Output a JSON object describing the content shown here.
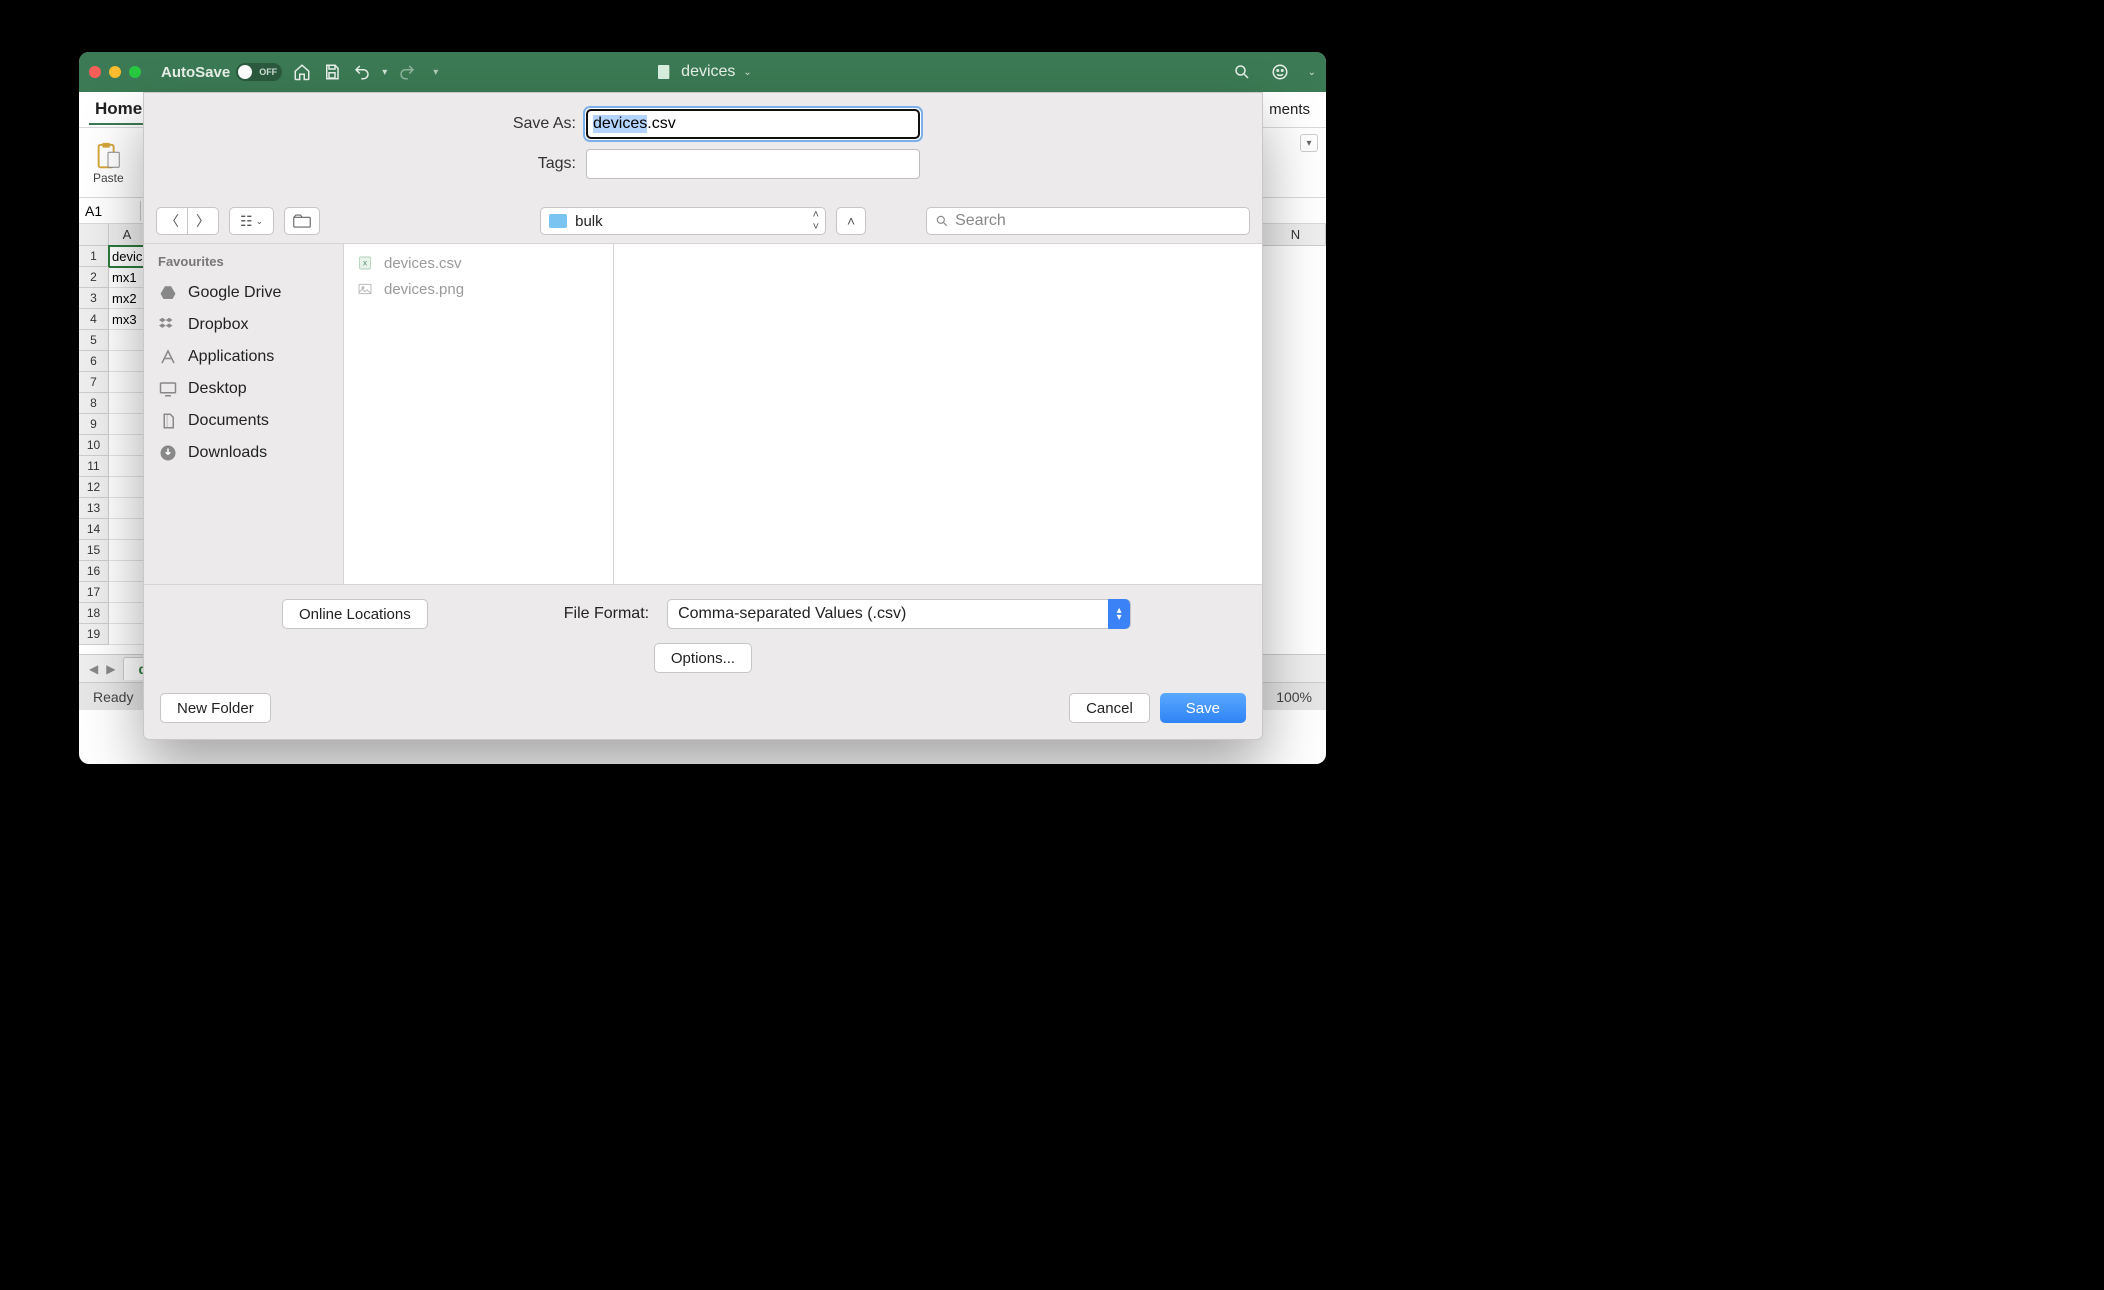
{
  "titlebar": {
    "autosave_label": "AutoSave",
    "autosave_state": "OFF",
    "doc_title": "devices"
  },
  "ribbon": {
    "home_tab": "Home",
    "comments_fragment": "ments",
    "paste_label": "Paste"
  },
  "namebox": {
    "ref": "A1"
  },
  "grid": {
    "col_headers": [
      "A",
      "N"
    ],
    "rows": [
      {
        "n": "1",
        "a": "devic"
      },
      {
        "n": "2",
        "a": "mx1"
      },
      {
        "n": "3",
        "a": "mx2"
      },
      {
        "n": "4",
        "a": "mx3"
      },
      {
        "n": "5",
        "a": ""
      },
      {
        "n": "6",
        "a": ""
      },
      {
        "n": "7",
        "a": ""
      },
      {
        "n": "8",
        "a": ""
      },
      {
        "n": "9",
        "a": ""
      },
      {
        "n": "10",
        "a": ""
      },
      {
        "n": "11",
        "a": ""
      },
      {
        "n": "12",
        "a": ""
      },
      {
        "n": "13",
        "a": ""
      },
      {
        "n": "14",
        "a": ""
      },
      {
        "n": "15",
        "a": ""
      },
      {
        "n": "16",
        "a": ""
      },
      {
        "n": "17",
        "a": ""
      },
      {
        "n": "18",
        "a": ""
      },
      {
        "n": "19",
        "a": ""
      }
    ]
  },
  "sheet": {
    "name": "devices"
  },
  "statusbar": {
    "ready": "Ready",
    "zoom": "100%"
  },
  "dialog": {
    "saveas_label": "Save As:",
    "saveas_value": "devices.csv",
    "tags_label": "Tags:",
    "tags_value": "",
    "folder": "bulk",
    "search_placeholder": "Search",
    "sidebar_header": "Favourites",
    "favourites": [
      {
        "icon": "gdrive",
        "label": "Google Drive"
      },
      {
        "icon": "dropbox",
        "label": "Dropbox"
      },
      {
        "icon": "apps",
        "label": "Applications"
      },
      {
        "icon": "desktop",
        "label": "Desktop"
      },
      {
        "icon": "docs",
        "label": "Documents"
      },
      {
        "icon": "downloads",
        "label": "Downloads"
      }
    ],
    "files": [
      {
        "icon": "xls",
        "name": "devices.csv"
      },
      {
        "icon": "img",
        "name": "devices.png"
      }
    ],
    "online_locations": "Online Locations",
    "file_format_label": "File Format:",
    "file_format_value": "Comma-separated Values (.csv)",
    "options_label": "Options...",
    "new_folder": "New Folder",
    "cancel": "Cancel",
    "save": "Save"
  }
}
